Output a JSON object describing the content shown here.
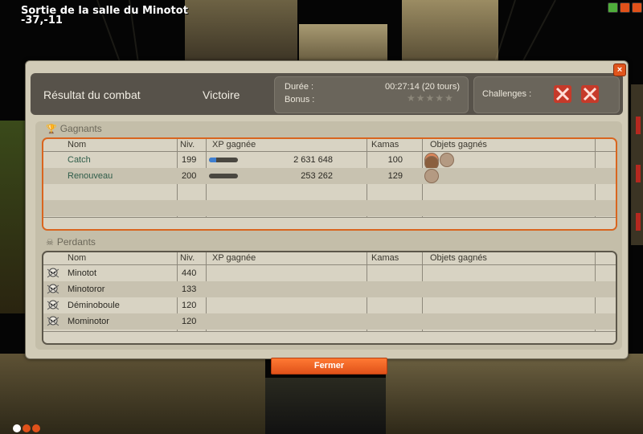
{
  "location": {
    "name": "Sortie de la salle du Minotot",
    "coords": "-37,-11"
  },
  "window": {
    "title": "Résultat du combat",
    "result": "Victoire",
    "duration_label": "Durée :",
    "duration_value": "00:27:14 (20 tours)",
    "bonus_label": "Bonus :",
    "bonus_stars": 0,
    "challenges_label": "Challenges :",
    "challenge_icons": [
      "challenge-failed-icon",
      "challenge-failed-icon"
    ],
    "close_symbol": "×"
  },
  "columns": {
    "name": "Nom",
    "level": "Niv.",
    "xp": "XP gagnée",
    "kamas": "Kamas",
    "items": "Objets gagnés"
  },
  "winners": {
    "title": "Gagnants",
    "rows": [
      {
        "name": "Catch",
        "level": "199",
        "xp": "2 631 648",
        "xp_fill": 0.25,
        "kamas": "100",
        "items": [
          "bone-item-icon",
          "cookie-item-icon",
          "dagger-item-icon"
        ]
      },
      {
        "name": "Renouveau",
        "level": "200",
        "xp": "253 262",
        "xp_fill": 0.0,
        "kamas": "129",
        "items": [
          "cookie-item-icon"
        ]
      }
    ]
  },
  "losers": {
    "title": "Perdants",
    "rows": [
      {
        "name": "Minotot",
        "level": "440"
      },
      {
        "name": "Minotoror",
        "level": "133"
      },
      {
        "name": "Déminoboule",
        "level": "120"
      },
      {
        "name": "Mominotor",
        "level": "120"
      }
    ]
  },
  "footer": {
    "close_button": "Fermer"
  },
  "colors": {
    "accent": "#e0511a",
    "winner_border": "#d9651f",
    "challenge_fail": "#c63a2a"
  }
}
